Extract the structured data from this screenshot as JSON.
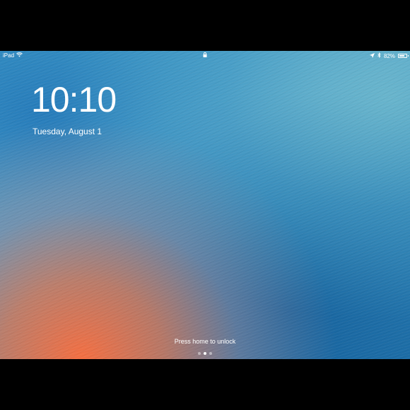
{
  "status_bar": {
    "device": "iPad",
    "wifi_icon": "wifi-icon",
    "lock_icon": "lock-icon",
    "location_icon": "location-arrow-icon",
    "bluetooth_icon": "bluetooth-icon",
    "battery_percent_label": "82%",
    "battery_level": 0.82
  },
  "lock_screen": {
    "time": "10:10",
    "date": "Tuesday, August 1",
    "unlock_hint": "Press home to unlock",
    "page_indicator": {
      "count": 3,
      "active_index": 1
    }
  }
}
